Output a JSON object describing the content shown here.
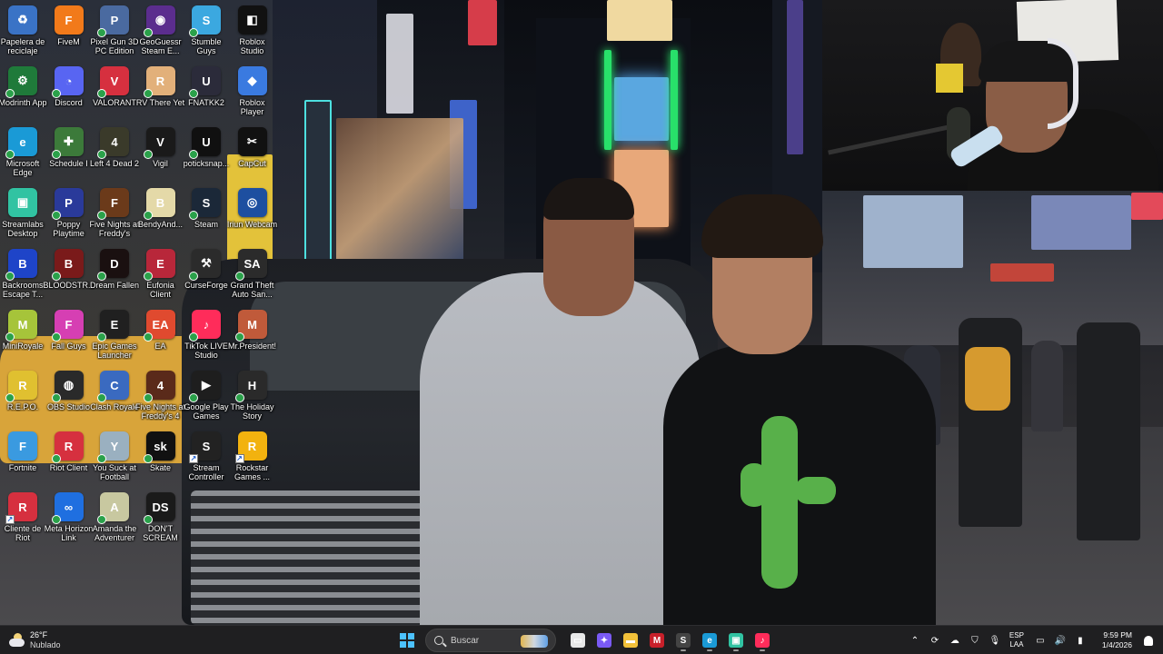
{
  "desktop": {
    "icons": [
      {
        "label": "Papelera de reciclaje",
        "icon": "recycle-bin-icon",
        "color": "#3a73c6",
        "glyph": "♻",
        "badge": "none"
      },
      {
        "label": "FiveM",
        "icon": "fivem-icon",
        "color": "#f27a1a",
        "glyph": "F",
        "badge": "none"
      },
      {
        "label": "Pixel Gun 3D PC Edition",
        "icon": "pixel-gun-icon",
        "color": "#4a6aa0",
        "glyph": "P",
        "badge": "check"
      },
      {
        "label": "GeoGuessr Steam E...",
        "icon": "geoguessr-icon",
        "color": "#5b2d8e",
        "glyph": "◉",
        "badge": "check"
      },
      {
        "label": "Stumble Guys",
        "icon": "stumble-guys-icon",
        "color": "#3ba8e0",
        "glyph": "S",
        "badge": "check"
      },
      {
        "label": "Roblox Studio",
        "icon": "roblox-studio-icon",
        "color": "#111111",
        "glyph": "◧",
        "badge": "none"
      },
      {
        "label": "Modrinth App",
        "icon": "modrinth-icon",
        "color": "#1f7a3a",
        "glyph": "⚙",
        "badge": "check"
      },
      {
        "label": "Discord",
        "icon": "discord-icon",
        "color": "#5865f2",
        "glyph": "◔",
        "badge": "check"
      },
      {
        "label": "VALORANT",
        "icon": "valorant-icon",
        "color": "#d6303f",
        "glyph": "V",
        "badge": "check"
      },
      {
        "label": "RV There Yet",
        "icon": "rv-there-yet-icon",
        "color": "#e2b07a",
        "glyph": "R",
        "badge": "check"
      },
      {
        "label": "FNATKK2",
        "icon": "fnatkk2-icon",
        "color": "#2b2b3a",
        "glyph": "U",
        "badge": "check"
      },
      {
        "label": "Roblox Player",
        "icon": "roblox-player-icon",
        "color": "#3a7ae0",
        "glyph": "◆",
        "badge": "none"
      },
      {
        "label": "Microsoft Edge",
        "icon": "edge-icon",
        "color": "#1a9ad6",
        "glyph": "e",
        "badge": "check"
      },
      {
        "label": "Schedule I",
        "icon": "schedule-one-icon",
        "color": "#3c7a3a",
        "glyph": "✚",
        "badge": "check"
      },
      {
        "label": "Left 4 Dead 2",
        "icon": "left4dead2-icon",
        "color": "#3a3a2a",
        "glyph": "4",
        "badge": "check"
      },
      {
        "label": "Vigil",
        "icon": "vigil-icon",
        "color": "#1a1a1a",
        "glyph": "V",
        "badge": "check"
      },
      {
        "label": "poticksnap...",
        "icon": "unreal-icon",
        "color": "#101010",
        "glyph": "U",
        "badge": "check"
      },
      {
        "label": "CapCut",
        "icon": "capcut-icon",
        "color": "#111111",
        "glyph": "✂",
        "badge": "none"
      },
      {
        "label": "Streamlabs Desktop",
        "icon": "streamlabs-icon",
        "color": "#31c3a2",
        "glyph": "▣",
        "badge": "none"
      },
      {
        "label": "Poppy Playtime",
        "icon": "poppy-playtime-icon",
        "color": "#2a3a9a",
        "glyph": "P",
        "badge": "check"
      },
      {
        "label": "Five Nights at Freddy's",
        "icon": "fnaf-icon",
        "color": "#6b3a1a",
        "glyph": "F",
        "badge": "check"
      },
      {
        "label": "BendyAnd...",
        "icon": "bendy-icon",
        "color": "#e4d9a8",
        "glyph": "B",
        "badge": "check"
      },
      {
        "label": "Steam",
        "icon": "steam-icon",
        "color": "#1b2838",
        "glyph": "S",
        "badge": "check"
      },
      {
        "label": "Iriun Webcam",
        "icon": "iriun-webcam-icon",
        "color": "#1d4fa0",
        "glyph": "◎",
        "badge": "none"
      },
      {
        "label": "Backrooms Escape T...",
        "icon": "backrooms-icon",
        "color": "#1e44c8",
        "glyph": "B",
        "badge": "check"
      },
      {
        "label": "BLOODSTR...",
        "icon": "bloodstrike-icon",
        "color": "#7a1a1a",
        "glyph": "B",
        "badge": "check"
      },
      {
        "label": "Dream Fallen",
        "icon": "dream-fallen-icon",
        "color": "#1a1010",
        "glyph": "D",
        "badge": "check"
      },
      {
        "label": "Eufonia Client",
        "icon": "eufonia-icon",
        "color": "#b8273a",
        "glyph": "E",
        "badge": "check"
      },
      {
        "label": "CurseForge",
        "icon": "curseforge-icon",
        "color": "#2b2b2b",
        "glyph": "⚒",
        "badge": "check"
      },
      {
        "label": "Grand Theft Auto San...",
        "icon": "gta-sa-icon",
        "color": "#2b2b2b",
        "glyph": "SA",
        "badge": "check"
      },
      {
        "label": "MiniRoyale",
        "icon": "mini-royale-icon",
        "color": "#a6c43a",
        "glyph": "M",
        "badge": "check"
      },
      {
        "label": "Fall Guys",
        "icon": "fall-guys-icon",
        "color": "#d63fb3",
        "glyph": "F",
        "badge": "check"
      },
      {
        "label": "Epic Games Launcher",
        "icon": "epic-games-icon",
        "color": "#202020",
        "glyph": "E",
        "badge": "check"
      },
      {
        "label": "EA",
        "icon": "ea-icon",
        "color": "#e04a2f",
        "glyph": "EA",
        "badge": "check"
      },
      {
        "label": "TikTok LIVE Studio",
        "icon": "tiktok-live-icon",
        "color": "#ff2c5a",
        "glyph": "♪",
        "badge": "check"
      },
      {
        "label": "Mr.President!",
        "icon": "mr-president-icon",
        "color": "#c05a3a",
        "glyph": "M",
        "badge": "check"
      },
      {
        "label": "R.E.P.O.",
        "icon": "repo-icon",
        "color": "#e0c030",
        "glyph": "R",
        "badge": "check"
      },
      {
        "label": "OBS Studio",
        "icon": "obs-icon",
        "color": "#2a2a2a",
        "glyph": "◍",
        "badge": "check"
      },
      {
        "label": "Clash Royale",
        "icon": "clash-royale-icon",
        "color": "#3a6ac0",
        "glyph": "C",
        "badge": "check"
      },
      {
        "label": "Five Nights at Freddy's 4",
        "icon": "fnaf4-icon",
        "color": "#5a2a1a",
        "glyph": "4",
        "badge": "check"
      },
      {
        "label": "Google Play Games",
        "icon": "google-play-games-icon",
        "color": "#1e1e1e",
        "glyph": "▶",
        "badge": "check"
      },
      {
        "label": "The Holiday Story",
        "icon": "holiday-story-icon",
        "color": "#2a2a2a",
        "glyph": "H",
        "badge": "check"
      },
      {
        "label": "Fortnite",
        "icon": "fortnite-icon",
        "color": "#3a9ae0",
        "glyph": "F",
        "badge": "none"
      },
      {
        "label": "Riot Client",
        "icon": "riot-client-icon",
        "color": "#d6303f",
        "glyph": "R",
        "badge": "check"
      },
      {
        "label": "You Suck at Football",
        "icon": "you-suck-at-football-icon",
        "color": "#9ab0c0",
        "glyph": "Y",
        "badge": "check"
      },
      {
        "label": "Skate",
        "icon": "skate-icon",
        "color": "#111111",
        "glyph": "sk",
        "badge": "check"
      },
      {
        "label": "Stream Controller",
        "icon": "stream-controller-icon",
        "color": "#222222",
        "glyph": "S",
        "badge": "arrow"
      },
      {
        "label": "Rockstar Games ...",
        "icon": "rockstar-icon",
        "color": "#f2b20f",
        "glyph": "R",
        "badge": "arrow"
      },
      {
        "label": "Cliente de Riot",
        "icon": "cliente-riot-icon",
        "color": "#d6303f",
        "glyph": "R",
        "badge": "arrow"
      },
      {
        "label": "Meta Horizon Link",
        "icon": "meta-horizon-icon",
        "color": "#1f6fe0",
        "glyph": "∞",
        "badge": "check"
      },
      {
        "label": "Amanda the Adventurer",
        "icon": "amanda-icon",
        "color": "#c8c8a0",
        "glyph": "A",
        "badge": "check"
      },
      {
        "label": "DON'T SCREAM",
        "icon": "dont-scream-icon",
        "color": "#1a1a1a",
        "glyph": "DS",
        "badge": "check"
      }
    ]
  },
  "taskbar": {
    "weather": {
      "temp": "26°F",
      "condition": "Nublado"
    },
    "search_placeholder": "Buscar",
    "apps": [
      {
        "name": "task-view",
        "icon": "task-view-icon",
        "color": "#e8e8e8",
        "glyph": "▭",
        "running": false
      },
      {
        "name": "copilot",
        "icon": "copilot-icon",
        "color": "#7a5af5",
        "glyph": "✦",
        "running": false
      },
      {
        "name": "file-explorer",
        "icon": "folder-icon",
        "color": "#f2c13a",
        "glyph": "▬",
        "running": false
      },
      {
        "name": "mcafee",
        "icon": "shield-icon",
        "color": "#c8202a",
        "glyph": "M",
        "running": false
      },
      {
        "name": "stream-controller",
        "icon": "stream-controller-icon",
        "color": "#444444",
        "glyph": "S",
        "running": true
      },
      {
        "name": "edge",
        "icon": "edge-icon",
        "color": "#1a9ad6",
        "glyph": "e",
        "running": true
      },
      {
        "name": "streamlabs",
        "icon": "streamlabs-icon",
        "color": "#31c3a2",
        "glyph": "▣",
        "running": true
      },
      {
        "name": "tiktok-live-studio",
        "icon": "tiktok-icon",
        "color": "#ff2c5a",
        "glyph": "♪",
        "running": true
      }
    ],
    "tray": {
      "lang_top": "ESP",
      "lang_bottom": "LAA",
      "time": "9:59 PM",
      "date": "1/4/2026"
    }
  }
}
